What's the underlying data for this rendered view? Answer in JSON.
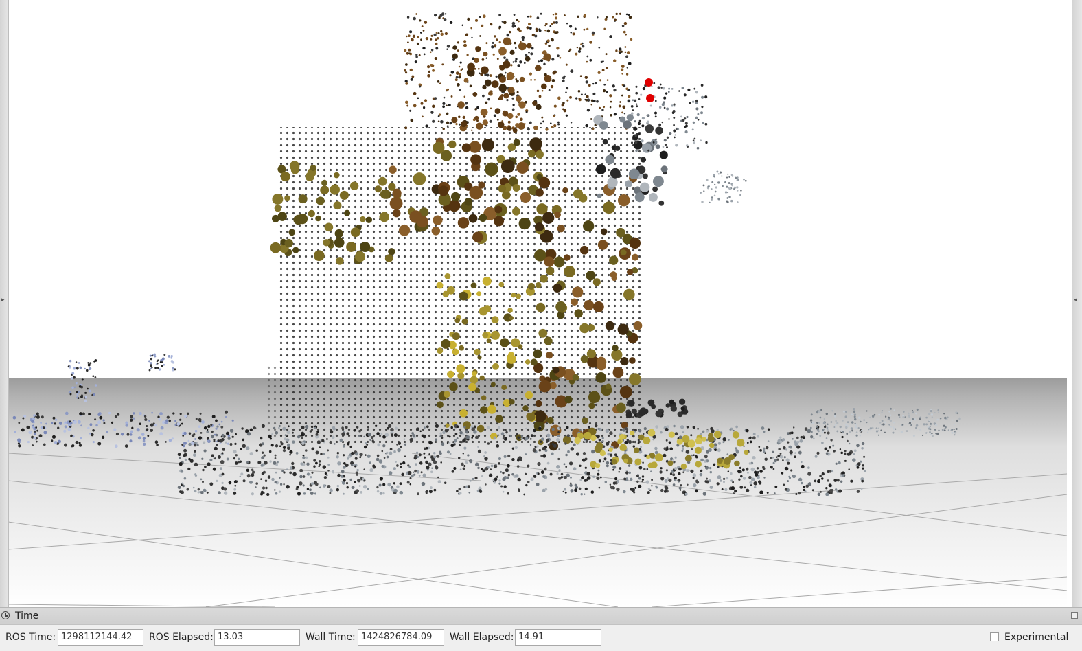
{
  "viewport": {
    "background_color": "#ffffff",
    "floor_color": "#bfbfbf",
    "grid_color": "#a0a0a0",
    "marker_color": "#e00000"
  },
  "time_panel": {
    "title": "Time",
    "icon": "clock-icon",
    "float_icon": "float-panel-icon",
    "ros_time_label": "ROS Time:",
    "ros_time_value": "1298112144.42",
    "ros_elapsed_label": "ROS Elapsed:",
    "ros_elapsed_value": "13.03",
    "wall_time_label": "Wall Time:",
    "wall_time_value": "1424826784.09",
    "wall_elapsed_label": "Wall Elapsed:",
    "wall_elapsed_value": "14.91",
    "experimental_label": "Experimental",
    "experimental_checked": false
  }
}
